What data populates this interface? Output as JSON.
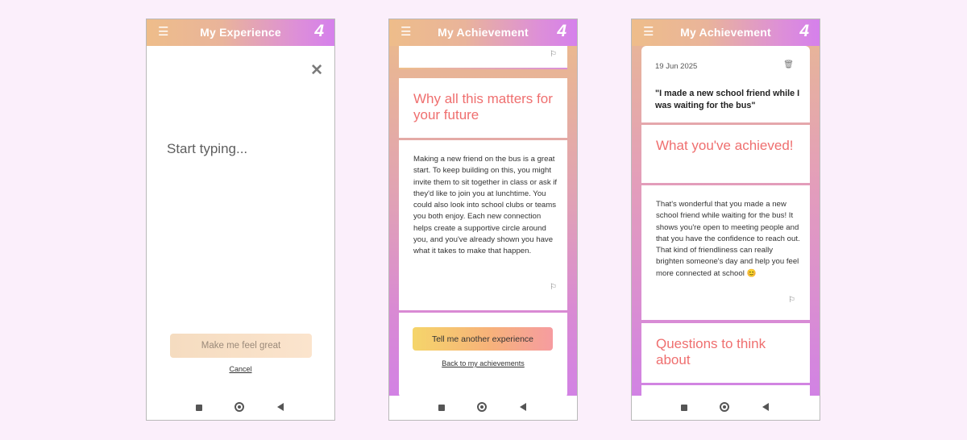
{
  "screens": [
    {
      "header": {
        "menu_icon": "☰",
        "title": "My Experience",
        "logo": "4"
      },
      "close_icon": "✕",
      "input_placeholder": "Start typing...",
      "primary_button": "Make me feel great",
      "cancel_link": "Cancel"
    },
    {
      "header": {
        "menu_icon": "☰",
        "title": "My Achievement",
        "logo": "4"
      },
      "flag_icon": "⚐",
      "heading": "Why all this matters for your future",
      "body": "Making a new friend on the bus is a great start. To keep building on this, you might invite them to sit together in class or ask if they'd like to join you at lunchtime. You could also look into school clubs or teams you both enjoy. Each new connection helps create a supportive circle around you, and you've already shown you have what it takes to make that happen.",
      "primary_button": "Tell me another experience",
      "back_link": "Back to my achievements"
    },
    {
      "header": {
        "menu_icon": "☰",
        "title": "My Achievement",
        "logo": "4"
      },
      "date": "19 Jun 2025",
      "trash_icon": "🗑",
      "quote": "\"I made a new school friend while I was waiting for the bus\"",
      "heading_achieved": "What you've achieved!",
      "body": "That's wonderful that you made a new school friend while waiting for the bus! It shows you're open to meeting people and that you have the confidence to reach out. That kind of friendliness can really brighten someone's day and help you feel more connected at school 😊",
      "flag_icon": "⚐",
      "heading_questions": "Questions to think about"
    }
  ],
  "colors": {
    "accent_heading": "#ef6f6f",
    "header_gradient_start": "#eebd8a",
    "header_gradient_end": "#d580ec"
  }
}
